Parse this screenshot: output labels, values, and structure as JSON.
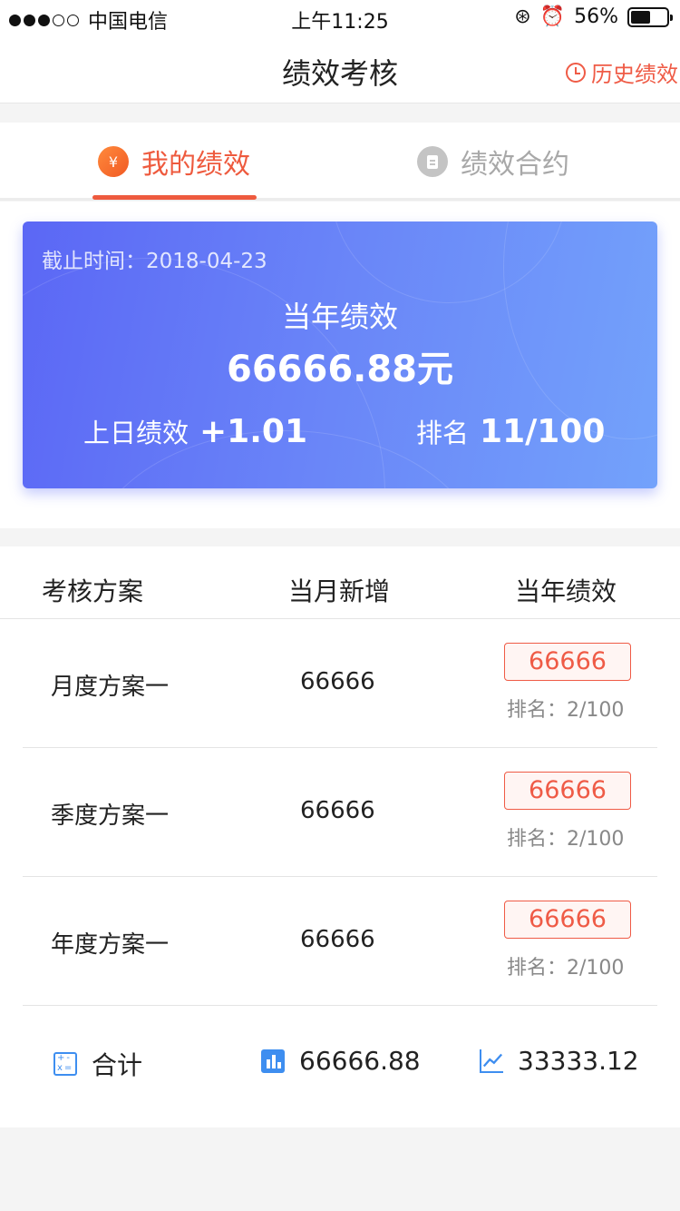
{
  "status_bar": {
    "carrier": "中国电信",
    "time": "上午11:25",
    "battery_text": "56%",
    "battery_level": 0.56
  },
  "nav": {
    "title": "绩效考核",
    "history_label": "历史绩效"
  },
  "tabs": [
    {
      "label": "我的绩效",
      "icon": "yen-icon",
      "active": true
    },
    {
      "label": "绩效合约",
      "icon": "document-icon",
      "active": false
    }
  ],
  "card": {
    "deadline": "截止时间：2018-04-23",
    "year_label": "当年绩效",
    "year_value": "66666.88元",
    "yesterday_label": "上日绩效",
    "yesterday_value": "+1.01",
    "rank_label": "排名",
    "rank_value": "11/100"
  },
  "table": {
    "headers": [
      "考核方案",
      "当月新增",
      "当年绩效"
    ],
    "rows": [
      {
        "name": "月度方案一",
        "month_new": "66666",
        "year_perf": "66666",
        "rank": "排名：2/100"
      },
      {
        "name": "季度方案一",
        "month_new": "66666",
        "year_perf": "66666",
        "rank": "排名：2/100"
      },
      {
        "name": "年度方案一",
        "month_new": "66666",
        "year_perf": "66666",
        "rank": "排名：2/100"
      }
    ],
    "total": {
      "label": "合计",
      "month_total": "66666.88",
      "year_total": "33333.12"
    }
  },
  "colors": {
    "accent": "#ee5a3e",
    "card_gradient_start": "#5b67f5",
    "card_gradient_end": "#73a2fb",
    "icon_blue": "#3e8ef0"
  }
}
